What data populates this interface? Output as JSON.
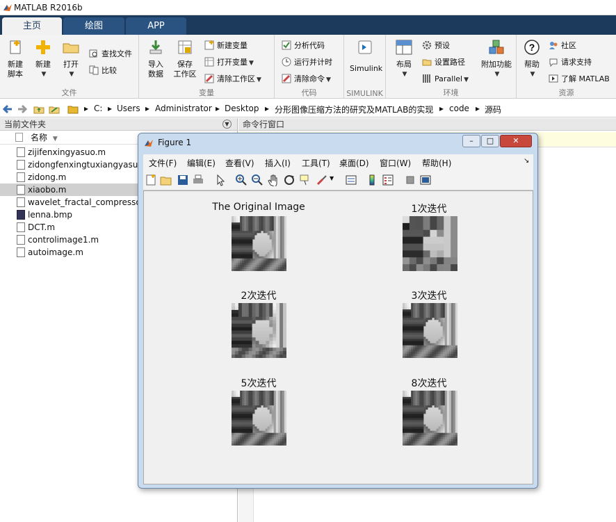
{
  "app": {
    "title": "MATLAB R2016b"
  },
  "tabs": [
    {
      "label": "主页"
    },
    {
      "label": "绘图"
    },
    {
      "label": "APP"
    }
  ],
  "ribbon": {
    "file": {
      "label": "文件",
      "new_script_l1": "新建",
      "new_script_l2": "脚本",
      "new": "新建",
      "open": "打开",
      "find_files": "查找文件",
      "compare": "比较"
    },
    "variable": {
      "label": "变量",
      "import_l1": "导入",
      "import_l2": "数据",
      "save_l1": "保存",
      "save_l2": "工作区",
      "new_variable": "新建变量",
      "open_variable": "打开变量",
      "clear_workspace": "清除工作区"
    },
    "code": {
      "label": "代码",
      "analyze": "分析代码",
      "run_and_time": "运行并计时",
      "clear_commands": "清除命令"
    },
    "simulink": {
      "label": "SIMULINK",
      "button": "Simulink"
    },
    "environment": {
      "label": "环境",
      "layout": "布局",
      "preferences": "预设",
      "set_path": "设置路径",
      "parallel": "Parallel",
      "addons": "附加功能"
    },
    "resources": {
      "label": "资源",
      "help": "帮助",
      "community": "社区",
      "request_support": "请求支持",
      "learn_matlab": "了解 MATLAB"
    }
  },
  "breadcrumb": [
    "C:",
    "Users",
    "Administrator",
    "Desktop",
    "分形图像压缩方法的研究及MATLAB的实现",
    "code",
    "源码"
  ],
  "current_folder": {
    "title": "当前文件夹",
    "column_name": "名称",
    "files": [
      {
        "name": "zijifenxingyasuo.m",
        "icon": "m-file-icon",
        "selected": false
      },
      {
        "name": "zidongfenxingtuxiangyasuo.m",
        "icon": "m-file-icon",
        "selected": false
      },
      {
        "name": "zidong.m",
        "icon": "m-file-icon",
        "selected": false
      },
      {
        "name": "xiaobo.m",
        "icon": "m-file-icon",
        "selected": true
      },
      {
        "name": "wavelet_fractal_compressor.m",
        "icon": "m-file-icon",
        "selected": false
      },
      {
        "name": "lenna.bmp",
        "icon": "bmp-file-icon",
        "selected": false
      },
      {
        "name": "DCT.m",
        "icon": "m-file-icon",
        "selected": false
      },
      {
        "name": "controlimage1.m",
        "icon": "m-file-icon",
        "selected": false
      },
      {
        "name": "autoimage.m",
        "icon": "m-file-icon",
        "selected": false
      }
    ]
  },
  "command_window": {
    "title": "命令行窗口"
  },
  "figure": {
    "title": "Figure 1",
    "menu": [
      "文件(F)",
      "编辑(E)",
      "查看(V)",
      "插入(I)",
      "工具(T)",
      "桌面(D)",
      "窗口(W)",
      "帮助(H)"
    ],
    "subplots": [
      {
        "title": "The Original Image",
        "blocks": 0
      },
      {
        "title": "1次迭代",
        "blocks": 8
      },
      {
        "title": "2次迭代",
        "blocks": 16
      },
      {
        "title": "3次迭代",
        "blocks": 0
      },
      {
        "title": "5次迭代",
        "blocks": 0
      },
      {
        "title": "8次迭代",
        "blocks": 0
      }
    ]
  },
  "colors": {
    "tabbar": "#1c3a5c",
    "ribbon": "#f3f3f3",
    "figure_frame": "#c9dbef",
    "selection": "#d0d0d0"
  }
}
